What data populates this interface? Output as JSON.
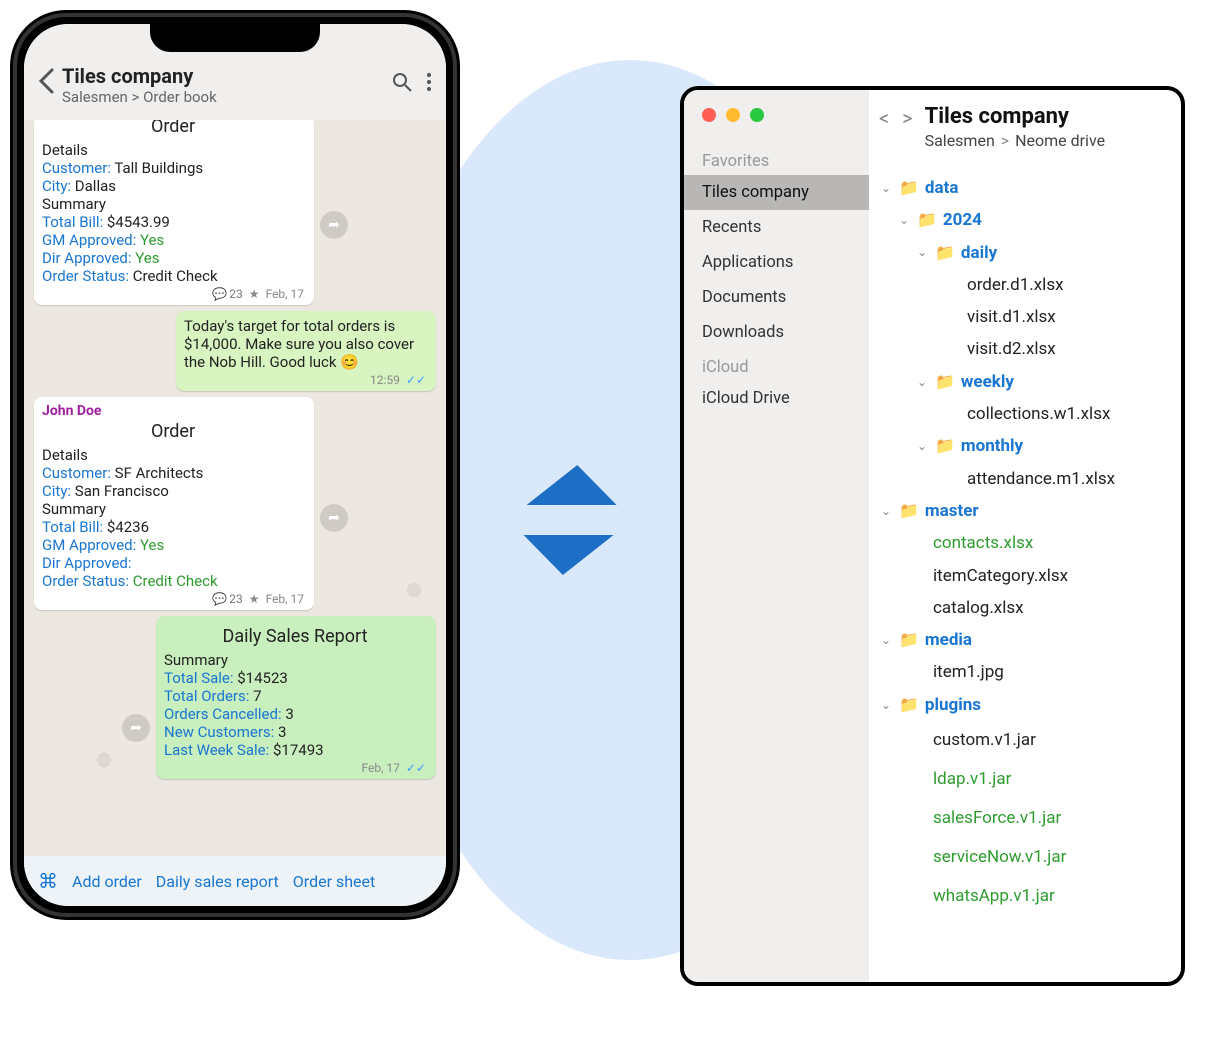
{
  "phone": {
    "title": "Tiles company",
    "breadcrumb": "Salesmen > Order book",
    "cards": [
      {
        "center_title": "Order",
        "detailsHead": "Details",
        "customerLbl": "Customer:",
        "customer": "Tall Buildings",
        "cityLbl": "City:",
        "city": "Dallas",
        "summaryHead": "Summary",
        "totalBillLbl": "Total Bill:",
        "totalBill": "$4543.99",
        "gmLbl": "GM Approved:",
        "gm": "Yes",
        "dirLbl": "Dir Approved:",
        "dir": "Yes",
        "statusLbl": "Order Status:",
        "status": "Credit Check",
        "comments": "23",
        "date": "Feb, 17"
      },
      {
        "text": "Today's target for total orders is $14,000. Make sure you also cover the Nob Hill. Good luck 😊",
        "time": "12:59"
      },
      {
        "sender": "John Doe",
        "center_title": "Order",
        "detailsHead": "Details",
        "customerLbl": "Customer:",
        "customer": "SF Architects",
        "cityLbl": "City:",
        "city": "San Francisco",
        "summaryHead": "Summary",
        "totalBillLbl": "Total Bill:",
        "totalBill": "$4236",
        "gmLbl": "GM Approved:",
        "gm": "Yes",
        "dirLbl": "Dir Approved:",
        "dir": "",
        "statusLbl": "Order Status:",
        "status": "Credit Check",
        "comments": "23",
        "date": "Feb, 17"
      },
      {
        "center_title": "Daily Sales Report",
        "summaryHead": "Summary",
        "totalSaleLbl": "Total Sale:",
        "totalSale": "$14523",
        "totalOrdersLbl": "Total Orders:",
        "totalOrders": "7",
        "cancelledLbl": "Orders Cancelled:",
        "cancelled": "3",
        "newCustLbl": "New Customers:",
        "newCust": "3",
        "lastWeekLbl": "Last Week Sale:",
        "lastWeek": "$17493",
        "date": "Feb, 17"
      }
    ],
    "bottom": {
      "addOrder": "Add order",
      "daily": "Daily sales report",
      "sheet": "Order sheet"
    }
  },
  "finder": {
    "title": "Tiles company",
    "bread1": "Salesmen",
    "bread2": "Neome drive",
    "sidebar": {
      "favorites": "Favorites",
      "items": [
        "Tiles company",
        "Recents",
        "Applications",
        "Documents",
        "Downloads"
      ],
      "icloudHead": "iCloud",
      "icloud": "iCloud Drive"
    },
    "tree": {
      "data": "data",
      "y2024": "2024",
      "daily": "daily",
      "daily_files": [
        "order.d1.xlsx",
        "visit.d1.xlsx",
        "visit.d2.xlsx"
      ],
      "weekly": "weekly",
      "weekly_files": [
        "collections.w1.xlsx"
      ],
      "monthly": "monthly",
      "monthly_files": [
        "attendance.m1.xlsx"
      ],
      "master": "master",
      "master_files": [
        {
          "name": "contacts.xlsx",
          "green": true
        },
        {
          "name": "itemCategory.xlsx",
          "green": false
        },
        {
          "name": "catalog.xlsx",
          "green": false
        }
      ],
      "media": "media",
      "media_files": [
        "item1.jpg"
      ],
      "plugins": "plugins",
      "plugins_files": [
        {
          "name": "custom.v1.jar",
          "green": false
        },
        {
          "name": "ldap.v1.jar",
          "green": true
        },
        {
          "name": "salesForce.v1.jar",
          "green": true
        },
        {
          "name": "serviceNow.v1.jar",
          "green": true
        },
        {
          "name": "whatsApp.v1.jar",
          "green": true
        }
      ]
    }
  }
}
